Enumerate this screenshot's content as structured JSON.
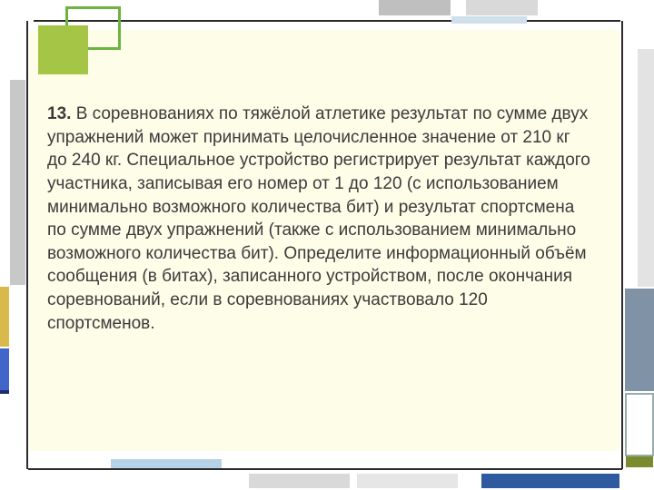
{
  "problem": {
    "number": "13.",
    "text": "В соревнованиях по тяжёлой атлетике результат по сумме двух упражнений может принимать целочисленное значение от 210 кг до 240 кг. Специальное устройство регистрирует результат каждого участника, записывая его номер от 1 до 120 (с использованием минимально возможного количества бит) и результат спортсмена по сумме двух упражнений (также с использованием минимально возможного количества бит). Определите информационный объём сообщения (в битах), записанного устройством, после окончания соревнований, если в соревнованиях участвовало 120 спортсменов."
  }
}
